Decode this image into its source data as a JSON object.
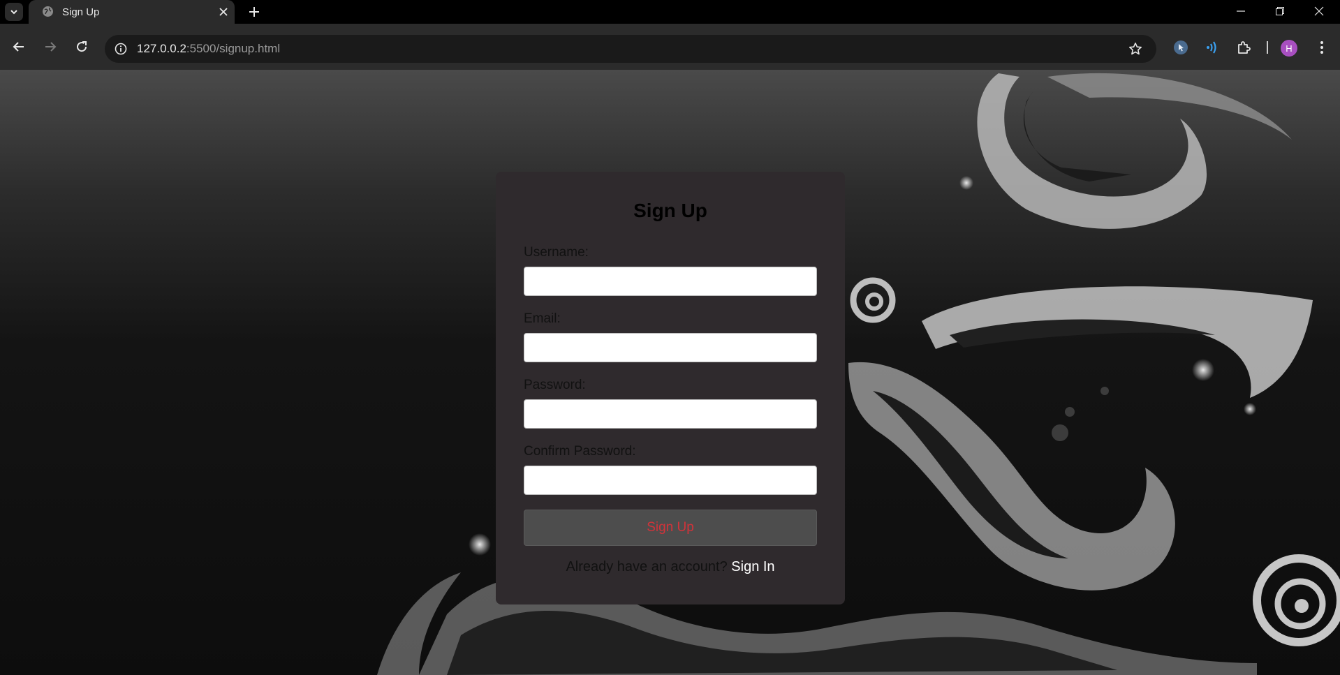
{
  "browser": {
    "tab": {
      "title": "Sign Up"
    },
    "address": {
      "host": "127.0.0.2",
      "rest": ":5500/signup.html"
    },
    "profile_initial": "H"
  },
  "form": {
    "title": "Sign Up",
    "fields": [
      {
        "label": "Username:",
        "value": ""
      },
      {
        "label": "Email:",
        "value": ""
      },
      {
        "label": "Password:",
        "value": ""
      },
      {
        "label": "Confirm Password:",
        "value": ""
      }
    ],
    "submit_label": "Sign Up",
    "footer_text": "Already have an account?",
    "footer_link": "Sign In"
  },
  "colors": {
    "card_bg": "#2f2a2d",
    "button_bg": "#4d4d4d",
    "button_text": "#d1333a",
    "link": "#ffffff"
  }
}
